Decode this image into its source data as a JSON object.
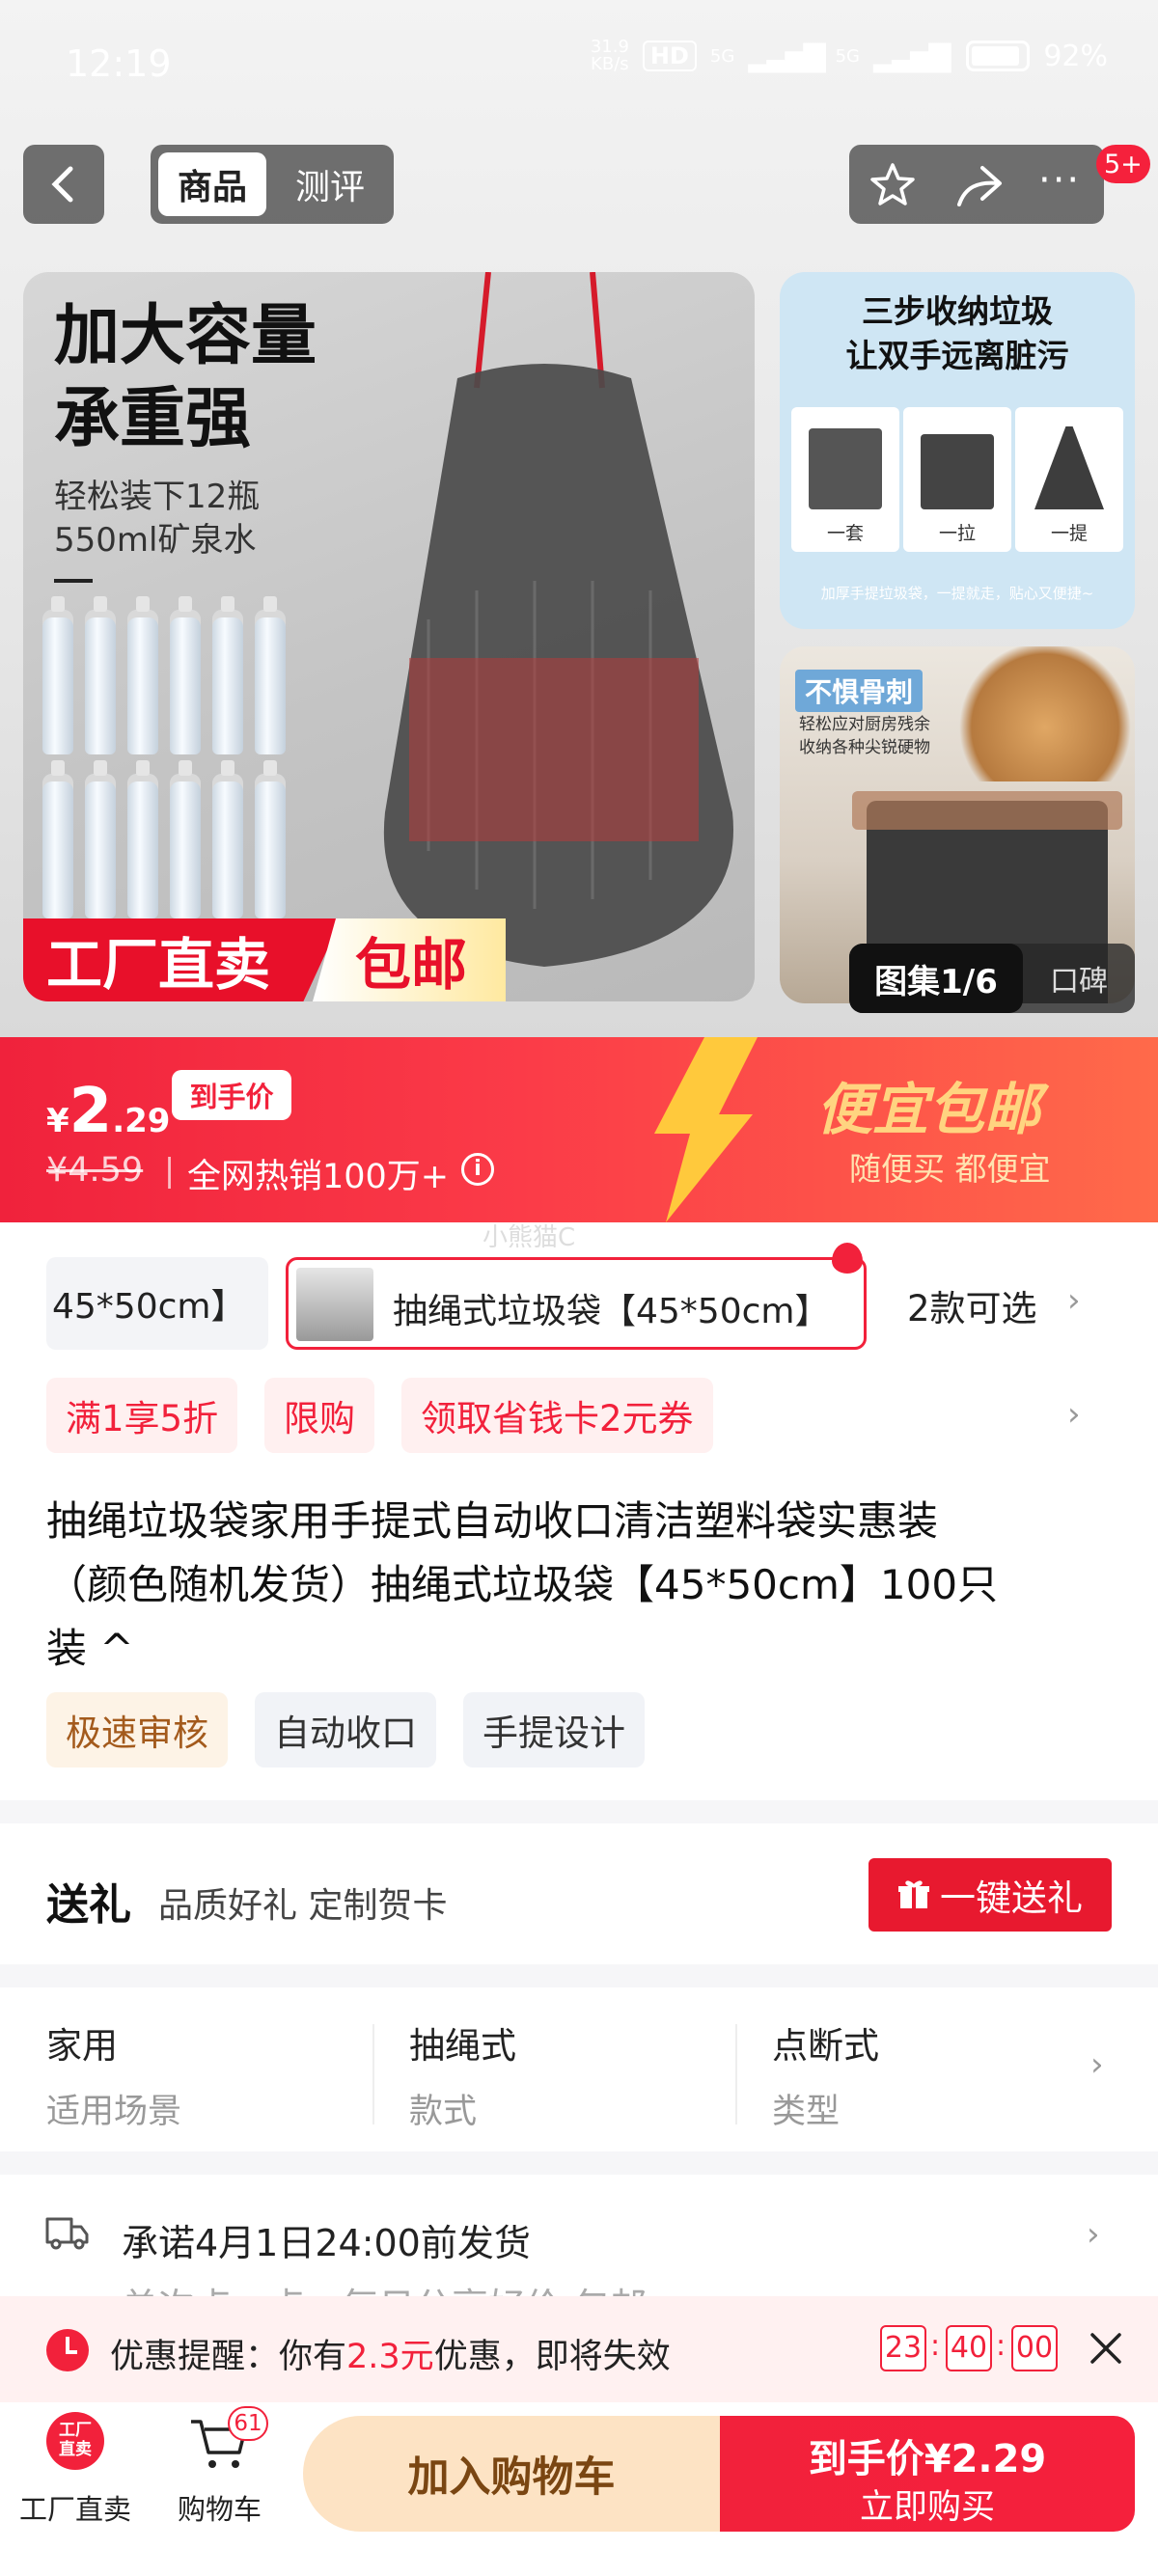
{
  "status": {
    "time": "12:19",
    "speed": "31.9\nKB/s",
    "hd": "HD",
    "sig1": "5G",
    "sig2": "5G",
    "battery": "92%"
  },
  "header": {
    "tab_product": "商品",
    "tab_review": "测评",
    "badge": "5+"
  },
  "main_image": {
    "headline1": "加大容量",
    "headline2": "承重强",
    "sub1": "轻松装下12瓶",
    "sub2": "550ml矿泉水",
    "factory": "工厂直卖",
    "free": "包邮"
  },
  "thumb1": {
    "title1": "三步收纳垃圾",
    "title2": "让双手远离脏污",
    "step1": "一套",
    "step2": "一拉",
    "step3": "一提",
    "foot": "加厚手提垃圾袋，一提就走，贴心又便捷~"
  },
  "thumb2": {
    "tag": "不惧骨刺",
    "sub1": "轻松应对厨房残余",
    "sub2": "收纳各种尖锐硬物"
  },
  "gallery": {
    "counter": "图集1/6",
    "review": "口碑"
  },
  "price": {
    "currency": "¥",
    "int": "2",
    "dec": ".29",
    "tag": "到手价",
    "orig": "¥4.59",
    "sep": "|",
    "hot": "全网热销100万+",
    "promo_big": "便宜包邮",
    "promo_small": "随便买 都便宜",
    "watermark": "小熊猫C"
  },
  "sku": {
    "prev": "45*50cm】",
    "selected": "抽绳式垃圾袋【45*50cm】",
    "count": "2款可选"
  },
  "promos": [
    "满1享5折",
    "限购",
    "领取省钱卡2元券"
  ],
  "title": {
    "line1": "抽绳垃圾袋家用手提式自动收口清洁塑料袋实惠装",
    "line2": "（颜色随机发货）抽绳式垃圾袋【45*50cm】100只",
    "line3": "装 ^"
  },
  "features": [
    "极速审核",
    "自动收口",
    "手提设计"
  ],
  "gift": {
    "title": "送礼",
    "sub": "品质好礼 定制贺卡",
    "button": "一键送礼"
  },
  "attrs": [
    {
      "value": "家用",
      "label": "适用场景"
    },
    {
      "value": "抽绳式",
      "label": "款式"
    },
    {
      "value": "点断式",
      "label": "类型"
    }
  ],
  "shipping": {
    "text": "承诺4月1日24:00前发货",
    "hidden": "单次点一点，每日分享好价 包邮"
  },
  "reminder": {
    "prefix": "优惠提醒：你有",
    "amount": "2.3元",
    "suffix": "优惠，即将失效",
    "hh": "23",
    "mm": "40",
    "ss": "00",
    "colon": ":"
  },
  "bottom": {
    "factory_icon": "工厂\n直卖",
    "factory": "工厂直卖",
    "cart": "购物车",
    "cart_badge": "61",
    "add_cart": "加入购物车",
    "buy_price_label": "到手价",
    "buy_price": "¥2.29",
    "buy_now": "立即购买"
  },
  "colors": {
    "accent": "#f2213b",
    "orange": "#ff7a1a"
  }
}
